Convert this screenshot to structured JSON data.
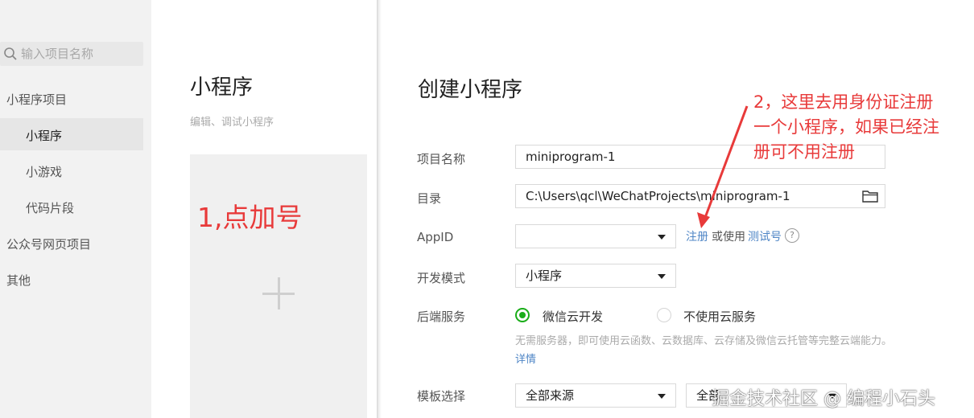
{
  "sidebar": {
    "search_placeholder": "输入项目名称",
    "group_miniprogram": "小程序项目",
    "items": [
      {
        "label": "小程序"
      },
      {
        "label": "小游戏"
      },
      {
        "label": "代码片段"
      }
    ],
    "group_official": "公众号网页项目",
    "group_other": "其他"
  },
  "middle": {
    "title": "小程序",
    "subtitle": "编辑、调试小程序",
    "annotation": "1,点加号"
  },
  "form": {
    "title": "创建小程序",
    "project_name_label": "项目名称",
    "project_name_value": "miniprogram-1",
    "directory_label": "目录",
    "directory_value": "C:\\Users\\qcl\\WeChatProjects\\miniprogram-1",
    "appid_label": "AppID",
    "appid_value": "",
    "register_link": "注册",
    "or_use_text": "或使用",
    "test_account_link": "测试号",
    "help_glyph": "?",
    "dev_mode_label": "开发模式",
    "dev_mode_value": "小程序",
    "backend_label": "后端服务",
    "backend_option_cloud": "微信云开发",
    "backend_option_none": "不使用云服务",
    "backend_selected": "微信云开发",
    "backend_desc": "无需服务器，即可使用云函数、云数据库、云存储及微信云托管等完整云端能力。",
    "details_link": "详情",
    "template_label": "模板选择",
    "template_source_value": "全部来源",
    "template_second_value": "全部"
  },
  "annotation2": {
    "line1": "2，这里去用身份证注册",
    "line2": "一个小程序，如果已经注",
    "line3": "册可不用注册"
  },
  "watermark": "掘金技术社区 @ 编程小石头",
  "colors": {
    "accent_green": "#1aad19",
    "link_blue": "#4f86c6",
    "annotation_red": "#e83a3a"
  }
}
